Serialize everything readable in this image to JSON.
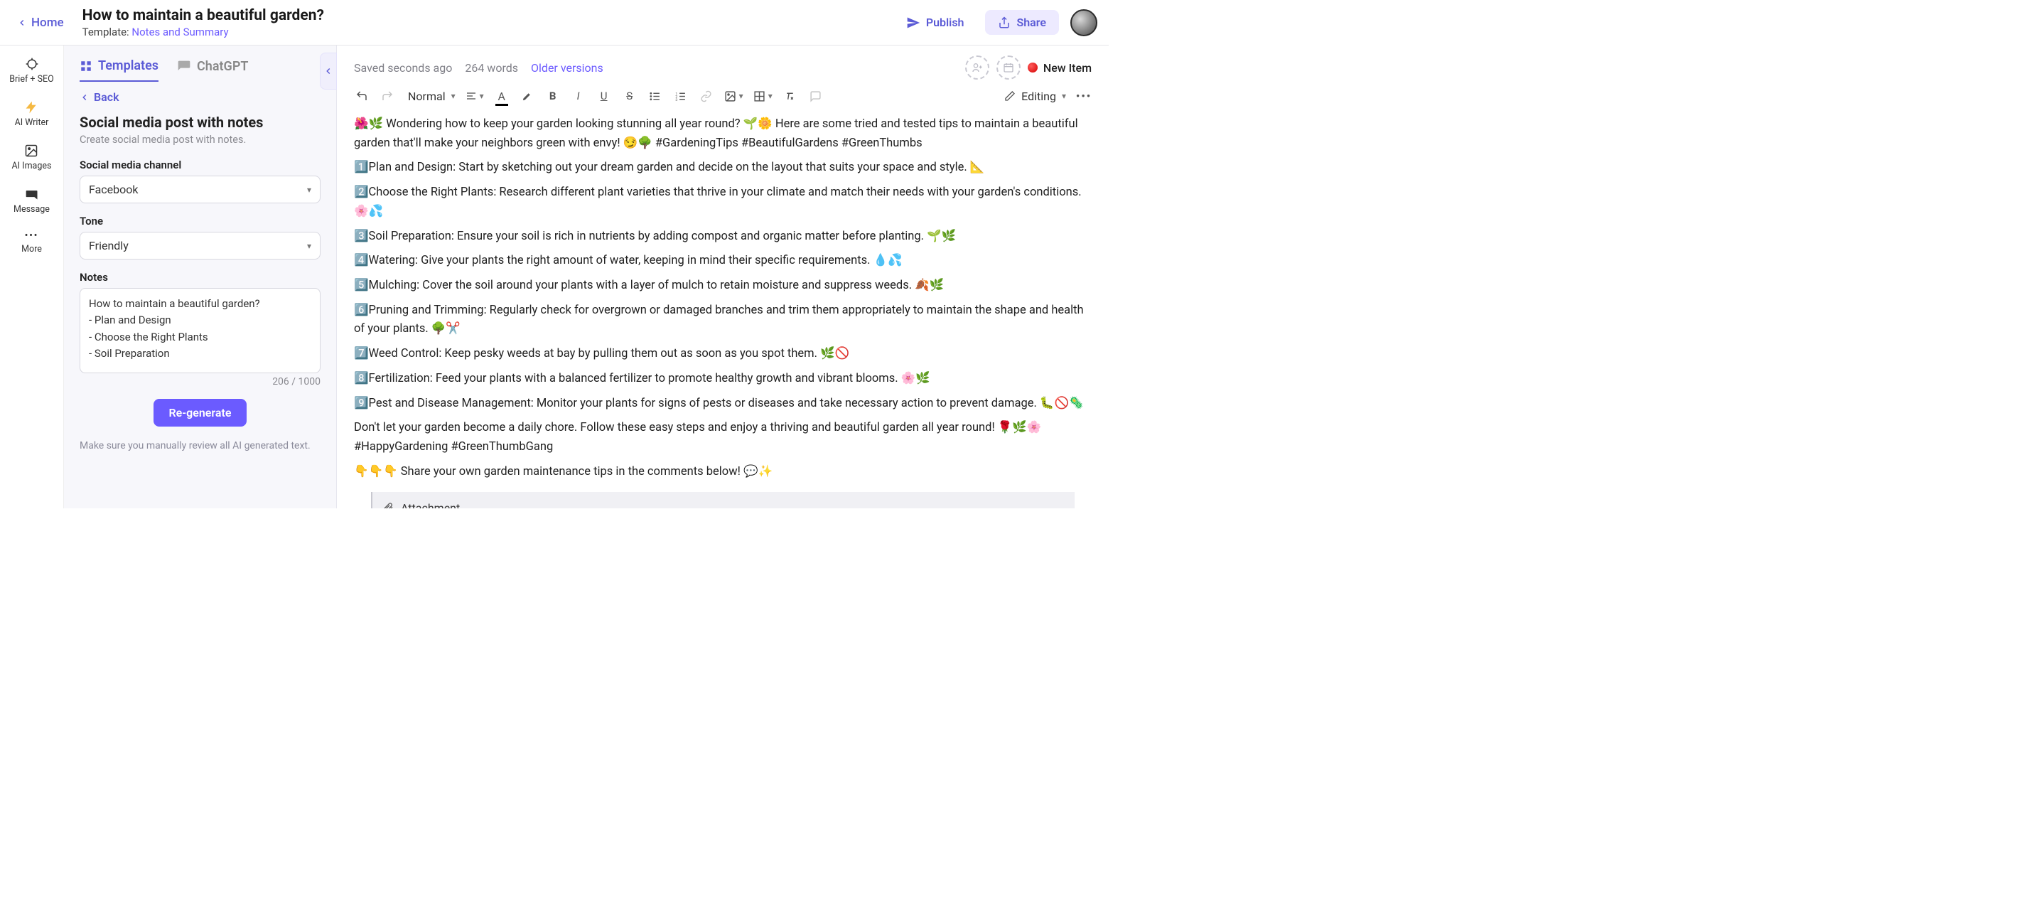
{
  "topbar": {
    "home_label": "Home",
    "doc_title": "How to maintain a beautiful garden?",
    "template_prefix": "Template: ",
    "template_link": "Notes and Summary",
    "publish_label": "Publish",
    "share_label": "Share"
  },
  "left_rail": {
    "items": [
      {
        "label": "Brief + SEO"
      },
      {
        "label": "AI Writer"
      },
      {
        "label": "AI Images"
      },
      {
        "label": "Message"
      },
      {
        "label": "More"
      }
    ]
  },
  "panel": {
    "tab_templates": "Templates",
    "tab_chatgpt": "ChatGPT",
    "back_label": "Back",
    "title": "Social media post with notes",
    "subtitle": "Create social media post with notes.",
    "channel_label": "Social media channel",
    "channel_value": "Facebook",
    "tone_label": "Tone",
    "tone_value": "Friendly",
    "notes_label": "Notes",
    "notes_value": "How to maintain a beautiful garden?\n- Plan and Design\n- Choose the Right Plants\n- Soil Preparation",
    "counter": "206 / 1000",
    "regen_label": "Re-generate",
    "review_text": "Make sure you manually review all AI generated text."
  },
  "editor_status": {
    "saved": "Saved seconds ago",
    "word_count": "264 words",
    "older_versions": "Older versions",
    "new_item": "New Item"
  },
  "toolbar": {
    "style_value": "Normal",
    "editing_label": "Editing"
  },
  "document": {
    "paragraphs": [
      "🌺🌿 Wondering how to keep your garden looking stunning all year round? 🌱🌼 Here are some tried and tested tips to maintain a beautiful garden that'll make your neighbors green with envy! 😏🌳 #GardeningTips #BeautifulGardens #GreenThumbs",
      "1️⃣Plan and Design: Start by sketching out your dream garden and decide on the layout that suits your space and style. 📐",
      "2️⃣Choose the Right Plants: Research different plant varieties that thrive in your climate and match their needs with your garden's conditions. 🌸💦",
      "3️⃣Soil Preparation: Ensure your soil is rich in nutrients by adding compost and organic matter before planting. 🌱🌿",
      "4️⃣Watering: Give your plants the right amount of water, keeping in mind their specific requirements. 💧💦",
      "5️⃣Mulching: Cover the soil around your plants with a layer of mulch to retain moisture and suppress weeds. 🍂🌿",
      "6️⃣Pruning and Trimming: Regularly check for overgrown or damaged branches and trim them appropriately to maintain the shape and health of your plants. 🌳✂️",
      "7️⃣Weed Control: Keep pesky weeds at bay by pulling them out as soon as you spot them. 🌿🚫",
      "8️⃣Fertilization: Feed your plants with a balanced fertilizer to promote healthy growth and vibrant blooms. 🌸🌿",
      "9️⃣Pest and Disease Management: Monitor your plants for signs of pests or diseases and take necessary action to prevent damage. 🐛🚫🦠",
      "Don't let your garden become a daily chore. Follow these easy steps and enjoy a thriving and beautiful garden all year round! 🌹🌿🌸 #HappyGardening #GreenThumbGang",
      "👇👇👇 Share your own garden maintenance tips in the comments below! 💬✨"
    ],
    "attachment_label": "Attachment"
  }
}
